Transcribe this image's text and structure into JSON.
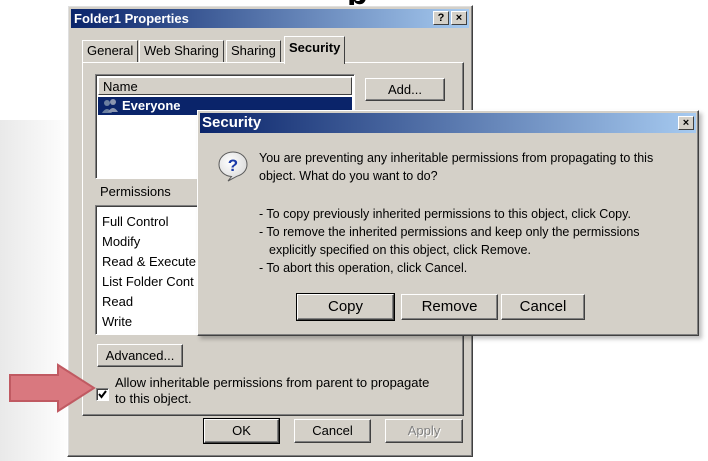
{
  "window": {
    "title": "Folder1 Properties",
    "help_btn": "?",
    "close_btn": "×"
  },
  "tabs": [
    {
      "label": "General"
    },
    {
      "label": "Web Sharing"
    },
    {
      "label": "Sharing"
    },
    {
      "label": "Security",
      "active": true
    }
  ],
  "names": {
    "column_header": "Name",
    "selected": "Everyone",
    "add_button": "Add..."
  },
  "permissions": {
    "label": "Permissions",
    "items": [
      {
        "label": "Full Control"
      },
      {
        "label": "Modify"
      },
      {
        "label": "Read & Execute"
      },
      {
        "label": "List Folder Cont"
      },
      {
        "label": "Read"
      },
      {
        "label": "Write"
      }
    ]
  },
  "advanced_button": "Advanced...",
  "inherit": {
    "checked": true,
    "label_line1": "Allow inheritable permissions from parent to propagate",
    "label_line2": "to this object."
  },
  "footer": {
    "ok": "OK",
    "cancel": "Cancel",
    "apply": "Apply"
  },
  "dialog": {
    "title": "Security",
    "close_btn": "×",
    "icon": "question-icon",
    "message_line1": "You are preventing any inheritable permissions from propagating to this",
    "message_line2": "object. What do you want to do?",
    "bullets": [
      "- To copy previously inherited permissions to this object, click Copy.",
      "- To remove the inherited permissions and keep only the permissions",
      "  explicitly specified on this object, click Remove.",
      "- To abort this operation, click Cancel."
    ],
    "copy_btn": "Copy",
    "remove_btn": "Remove",
    "cancel_btn": "Cancel"
  },
  "colors": {
    "arrow_fill": "#d9787f",
    "arrow_stroke": "#c05a62",
    "titlebar_start": "#0a246a",
    "titlebar_end": "#a6caf0",
    "face": "#d4d0c8"
  }
}
